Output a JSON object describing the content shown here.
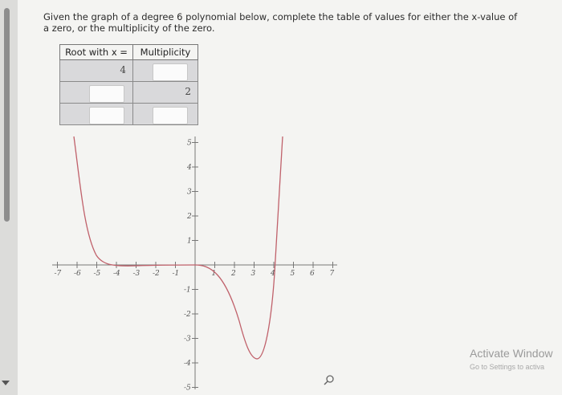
{
  "question": "Given the graph of a degree 6 polynomial below, complete the table of values for either the x-value of a zero, or the multiplicity of the zero.",
  "table": {
    "headers": [
      "Root with x =",
      "Multiplicity"
    ],
    "rows": [
      {
        "root": "4",
        "multiplicity": ""
      },
      {
        "root": "",
        "multiplicity": "2"
      },
      {
        "root": "",
        "multiplicity": ""
      }
    ]
  },
  "graph": {
    "x_ticks": [
      "-7",
      "-6",
      "-5",
      "-4",
      "-3",
      "-2",
      "-1",
      "1",
      "2",
      "3",
      "4",
      "5",
      "6",
      "7"
    ],
    "y_ticks": [
      "5",
      "4",
      "3",
      "2",
      "1",
      "-1",
      "-2",
      "-3",
      "-4",
      "-5"
    ],
    "curve_color": "#c0616b"
  },
  "watermark": {
    "title": "Activate Window",
    "subtitle": "Go to Settings to activa"
  },
  "icons": {
    "zoom": "magnifier-icon"
  }
}
